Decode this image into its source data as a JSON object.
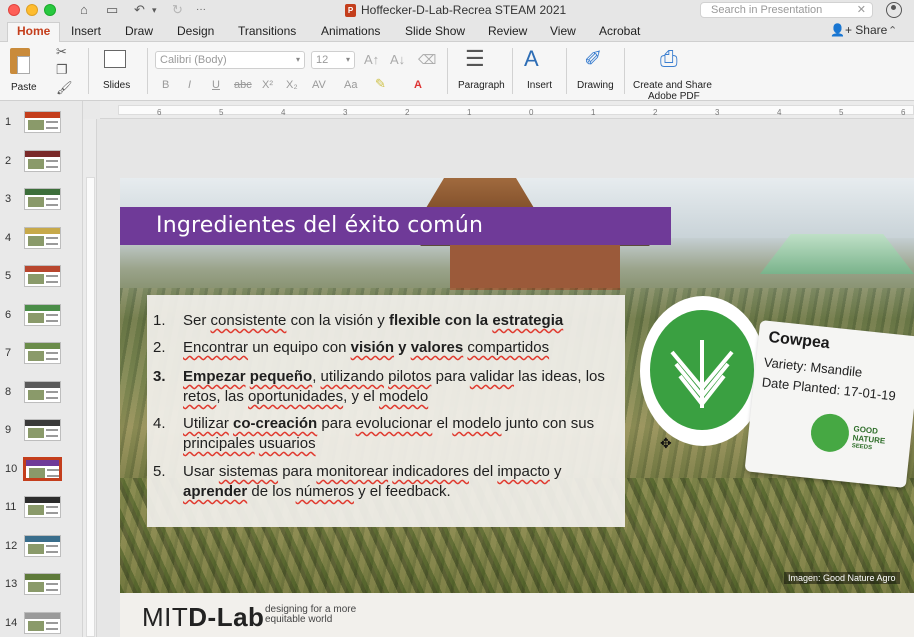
{
  "window": {
    "title": "Hoffecker-D-Lab-Recrea STEAM 2021",
    "search_placeholder": "Search in Presentation"
  },
  "tabs": [
    {
      "label": "Home",
      "active": true
    },
    {
      "label": "Insert"
    },
    {
      "label": "Draw"
    },
    {
      "label": "Design"
    },
    {
      "label": "Transitions"
    },
    {
      "label": "Animations"
    },
    {
      "label": "Slide Show"
    },
    {
      "label": "Review"
    },
    {
      "label": "View"
    },
    {
      "label": "Acrobat"
    }
  ],
  "share_label": "Share",
  "ribbon": {
    "paste": "Paste",
    "slides": "Slides",
    "font_name": "Calibri (Body)",
    "font_size": "12",
    "paragraph": "Paragraph",
    "insert": "Insert",
    "drawing": "Drawing",
    "create_share_line1": "Create and Share",
    "create_share_line2": "Adobe PDF",
    "fmt": [
      "B",
      "I",
      "U",
      "abc",
      "X²",
      "X₂",
      "AV",
      "Aa",
      "A"
    ]
  },
  "ruler": {
    "numbers": [
      "6",
      "5",
      "4",
      "3",
      "2",
      "1",
      "0",
      "1",
      "2",
      "3",
      "4",
      "5",
      "6"
    ]
  },
  "thumbnails": [
    {
      "num": "1",
      "band": "#c43e1c"
    },
    {
      "num": "2",
      "band": "#7a2a2a"
    },
    {
      "num": "3",
      "band": "#3c6e3a"
    },
    {
      "num": "4",
      "band": "#c7a94a"
    },
    {
      "num": "5",
      "band": "#b8462e"
    },
    {
      "num": "6",
      "band": "#4b8d48"
    },
    {
      "num": "7",
      "band": "#6a8c4a"
    },
    {
      "num": "8",
      "band": "#5a5a5a"
    },
    {
      "num": "9",
      "band": "#3a3a3a"
    },
    {
      "num": "10",
      "band": "#6f3a98",
      "active": true
    },
    {
      "num": "11",
      "band": "#2c2c2c"
    },
    {
      "num": "12",
      "band": "#3a6e8c"
    },
    {
      "num": "13",
      "band": "#5e7a3a"
    },
    {
      "num": "14",
      "band": "#9a9a9a"
    }
  ],
  "slide": {
    "title": "Ingredientes del éxito común",
    "credit": "Imagen: Good Nature Agro",
    "sign": {
      "title": "Cowpea",
      "variety": "Variety: Msandile",
      "planted": "Date Planted: 17-01-19",
      "brand_line1": "GOOD",
      "brand_line2": "NATURE",
      "brand_line3": "SEEDS"
    },
    "footer": {
      "logo_mit": "MIT",
      "logo_dlab": "D-Lab",
      "tag_line1": "designing for a more",
      "tag_line2": "equitable world"
    },
    "items": [
      {
        "num": "1."
      },
      {
        "num": "2."
      },
      {
        "num": "3."
      },
      {
        "num": "4."
      },
      {
        "num": "5."
      }
    ]
  },
  "colors": {
    "accent": "#c43e1c",
    "title_banner": "#6f3a98",
    "logo_green": "#3aa041"
  }
}
